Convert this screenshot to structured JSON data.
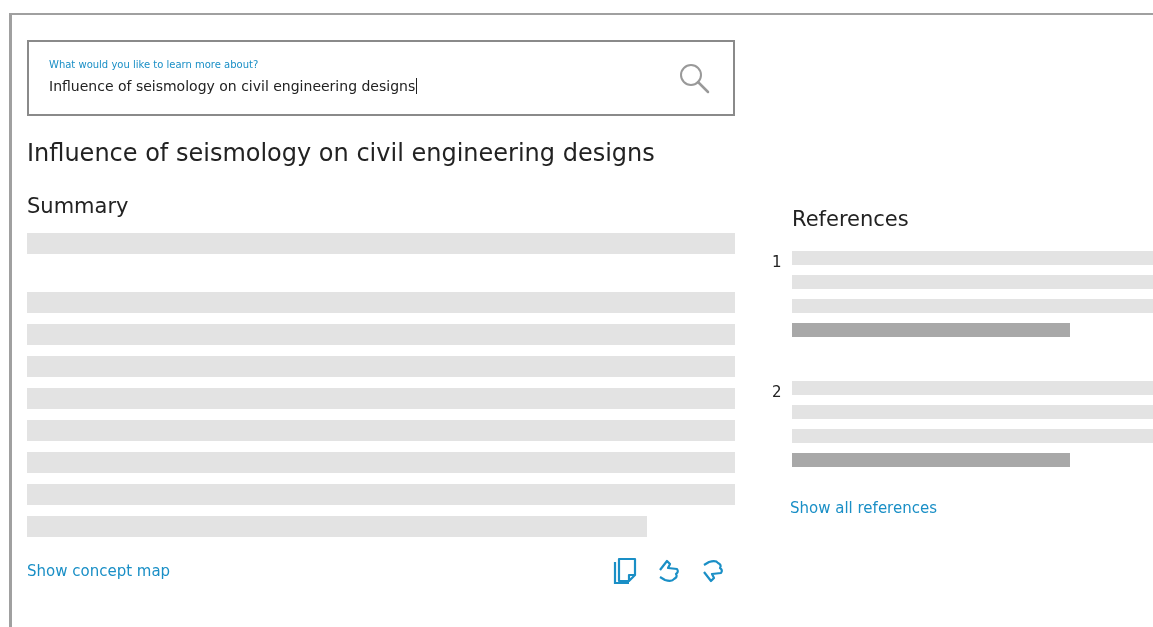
{
  "search": {
    "label": "What would you like to learn more about?",
    "value": "Influence of seismology on civil engineering designs"
  },
  "title": "Influence of seismology on civil engineering designs",
  "summary": {
    "heading": "Summary",
    "link": "Show concept map"
  },
  "references": {
    "heading": "References",
    "items": [
      {
        "number": "1"
      },
      {
        "number": "2"
      }
    ],
    "link": "Show all references"
  }
}
